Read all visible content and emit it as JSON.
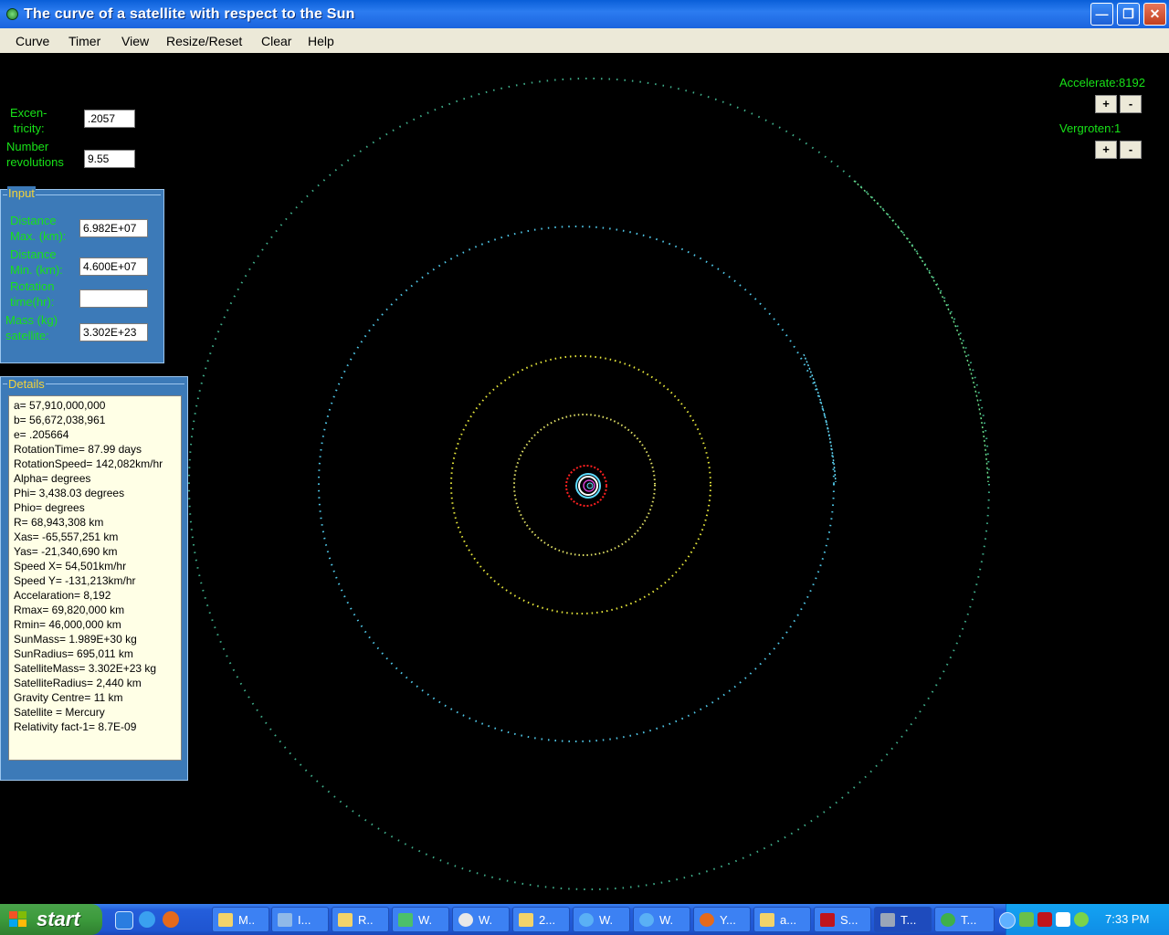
{
  "window": {
    "title": "The curve of a satellite with respect to the Sun"
  },
  "menu": [
    "Curve",
    "Timer",
    "View",
    "Resize/Reset",
    "Clear",
    "Help"
  ],
  "params": {
    "excentricity_label": "Excen-\n tricity:",
    "excentricity_value": ".2057",
    "revolutions_label": "Number\nrevolutions",
    "revolutions_value": "9.55"
  },
  "input": {
    "title": "Input",
    "dist_max_label": "Distance\nMax. (km):",
    "dist_max_value": "6.982E+07",
    "dist_min_label": "Distance\nMin. (km):",
    "dist_min_value": "4.600E+07",
    "rotation_label": "Rotation\ntime(hr):",
    "rotation_value": "",
    "mass_label": "Mass (kg)\nsatellite:",
    "mass_value": "3.302E+23"
  },
  "details": {
    "title": "Details",
    "lines": [
      "a= 57,910,000,000",
      "b= 56,672,038,961",
      "e= .205664",
      "RotationTime= 87.99 days",
      "RotationSpeed= 142,082km/hr",
      "Alpha=  degrees",
      "Phi= 3,438.03 degrees",
      "Phio=  degrees",
      "R= 68,943,308 km",
      "Xas= -65,557,251 km",
      "Yas= -21,340,690 km",
      "Speed X= 54,501km/hr",
      "Speed Y= -131,213km/hr",
      "Accelaration= 8,192",
      "Rmax= 69,820,000 km",
      "Rmin= 46,000,000 km",
      "SunMass= 1.989E+30 kg",
      "SunRadius= 695,011 km",
      "SatelliteMass= 3.302E+23 kg",
      "SatelliteRadius= 2,440 km",
      "Gravity Centre= 11 km",
      "Satellite = Mercury",
      "Relativity fact-1= 8.7E-09"
    ]
  },
  "controls": {
    "accelerate_label": "Accelerate:8192",
    "vergroten_label": "Vergroten:1",
    "plus": "+",
    "minus": "-"
  },
  "taskbar": {
    "start_label": "start",
    "buttons": [
      "M..",
      "I...",
      "R..",
      "W.",
      "W.",
      "2...",
      "W.",
      "W.",
      "Y...",
      "a...",
      "S...",
      "T...",
      "T..."
    ],
    "clock": "7:33 PM"
  }
}
